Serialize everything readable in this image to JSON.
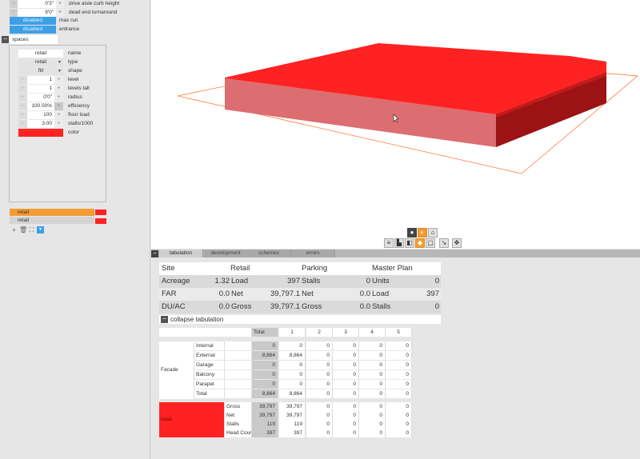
{
  "left": {
    "top_rows": [
      {
        "value": "0'3\"",
        "label": "drive aisle curb height"
      },
      {
        "value": "9'0\"",
        "label": "dead end turnaround"
      }
    ],
    "disabled_rows": [
      {
        "value": "disabled",
        "label": "max run"
      },
      {
        "value": "disabled",
        "label": "entrance"
      }
    ],
    "spaces_title": "spaces",
    "space_props": {
      "name": {
        "value": "retail",
        "label": "name"
      },
      "type": {
        "value": "retail",
        "label": "type"
      },
      "shape": {
        "value": "fill",
        "label": "shape"
      },
      "level": {
        "value": "1",
        "label": "level"
      },
      "levels_tall": {
        "value": "1",
        "label": "levels tall"
      },
      "radius": {
        "value": "0'0\"",
        "label": "radius"
      },
      "efficiency": {
        "value": "100.00%",
        "label": "efficiency"
      },
      "floor_load": {
        "value": "100",
        "label": "floor load"
      },
      "stalls": {
        "value": "3.00",
        "label": "stalls/1000"
      },
      "color": {
        "label": "color",
        "hex": "#ff2222"
      }
    },
    "layers": [
      {
        "label": "retail",
        "selected": true
      },
      {
        "label": "retail",
        "selected": false
      }
    ]
  },
  "tabs": [
    "tabulation",
    "development",
    "schemes",
    "errors"
  ],
  "summary": {
    "header": [
      "Site",
      "Retail",
      "Parking",
      "Master Plan"
    ],
    "rows": [
      [
        "Acreage",
        "1.32",
        "Load",
        "397",
        "Stalls",
        "0",
        "Units",
        "0"
      ],
      [
        "FAR",
        "0.0",
        "Net",
        "39,797.1",
        "Net",
        "0.0",
        "Load",
        "397"
      ],
      [
        "DU/AC",
        "0.0",
        "Gross",
        "39,797.1",
        "Gross",
        "0.0",
        "Stalls",
        "0"
      ]
    ]
  },
  "collapse_label": "collapse tabulation",
  "detail": {
    "columns": [
      "Total",
      "1",
      "2",
      "3",
      "4",
      "5"
    ],
    "facade": {
      "label": "Facade",
      "rows": [
        {
          "name": "Internal",
          "values": [
            "0",
            "0",
            "0",
            "0",
            "0",
            "0"
          ]
        },
        {
          "name": "External",
          "values": [
            "8,864",
            "8,864",
            "0",
            "0",
            "0",
            "0"
          ]
        },
        {
          "name": "Garage",
          "values": [
            "0",
            "0",
            "0",
            "0",
            "0",
            "0"
          ]
        },
        {
          "name": "Balcony",
          "values": [
            "0",
            "0",
            "0",
            "0",
            "0",
            "0"
          ]
        },
        {
          "name": "Parapet",
          "values": [
            "0",
            "0",
            "0",
            "0",
            "0",
            "0"
          ]
        },
        {
          "name": "Total",
          "values": [
            "8,864",
            "8,864",
            "0",
            "0",
            "0",
            "0"
          ]
        }
      ]
    },
    "retail": {
      "label": "retail",
      "color": "#ff2222",
      "rows": [
        {
          "name": "Gross",
          "values": [
            "39,797",
            "39,797",
            "0",
            "0",
            "0",
            "0"
          ]
        },
        {
          "name": "Net",
          "values": [
            "39,797",
            "39,797",
            "0",
            "0",
            "0",
            "0"
          ]
        },
        {
          "name": "Stalls",
          "values": [
            "119",
            "119",
            "0",
            "0",
            "0",
            "0"
          ]
        },
        {
          "name": "Head Cour",
          "values": [
            "397",
            "397",
            "0",
            "0",
            "0",
            "0"
          ]
        }
      ]
    }
  },
  "colors": {
    "accent_blue": "#3da0e6",
    "accent_orange": "#f39c33",
    "massing_red": "#ff2222"
  }
}
